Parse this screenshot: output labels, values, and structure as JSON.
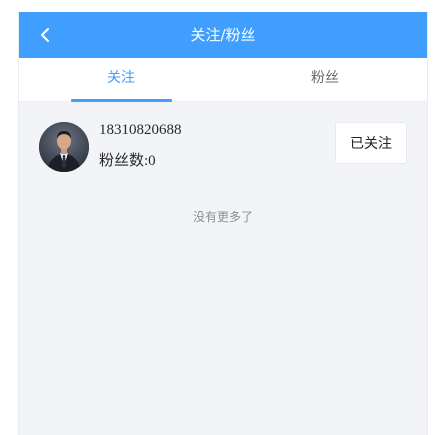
{
  "header": {
    "title": "关注/粉丝",
    "back_icon": "chevron-left-icon",
    "background_color": "#409eff"
  },
  "tabs": [
    {
      "label": "关注",
      "active": true
    },
    {
      "label": "粉丝",
      "active": false
    }
  ],
  "accent_color": "#409eff",
  "list": {
    "items": [
      {
        "name": "18310820688",
        "fans_text": "粉丝数:0",
        "button_label": "已关注",
        "avatar_icon": "user-avatar-photo"
      }
    ],
    "end_text": "没有更多了"
  }
}
